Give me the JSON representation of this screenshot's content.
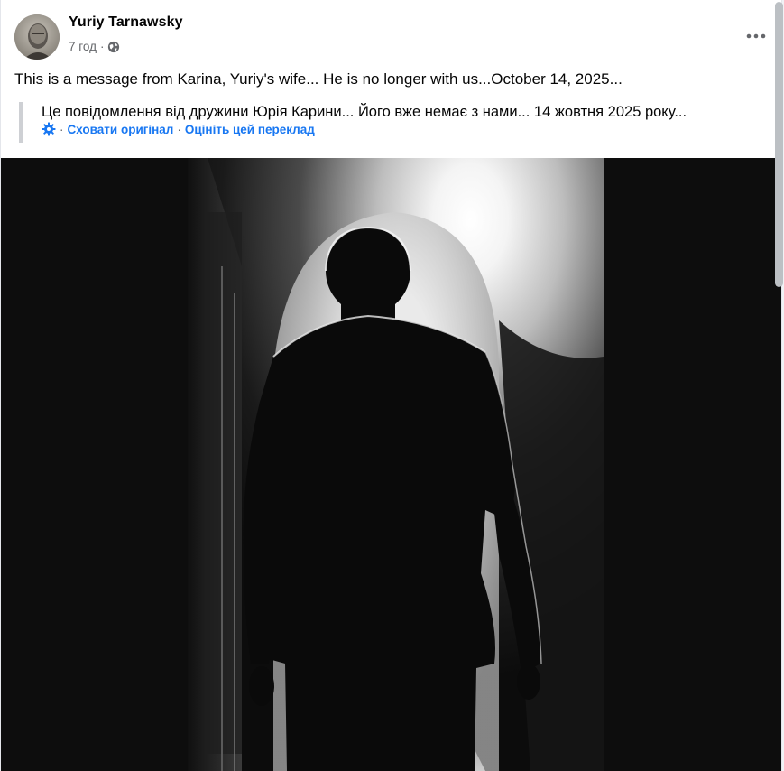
{
  "post": {
    "author": "Yuriy Tarnawsky",
    "time": "7 год",
    "separator": "·",
    "privacy_icon": "globe-icon",
    "more_icon": "more-horizontal-icon",
    "text": "This is a message from Karina, Yuriy's wife... He is no longer with us...October 14, 2025...",
    "translation": {
      "original_text": "Це повідомлення від дружини Юрія Карини... Його вже немає з нами... 14 жовтня 2025 року...",
      "settings_icon": "gear-icon",
      "hide_original": "Сховати оригінал",
      "link_separator": "·",
      "rate_translation": "Оцініть цей переклад"
    },
    "photo": {
      "subject": "black-and-white-silhouette-of-man-walking-toward-bright-doorway"
    }
  },
  "colors": {
    "link": "#1877f2",
    "secondary_text": "#65676b",
    "primary_text": "#050505",
    "photo_background": "#0d0d0d"
  }
}
